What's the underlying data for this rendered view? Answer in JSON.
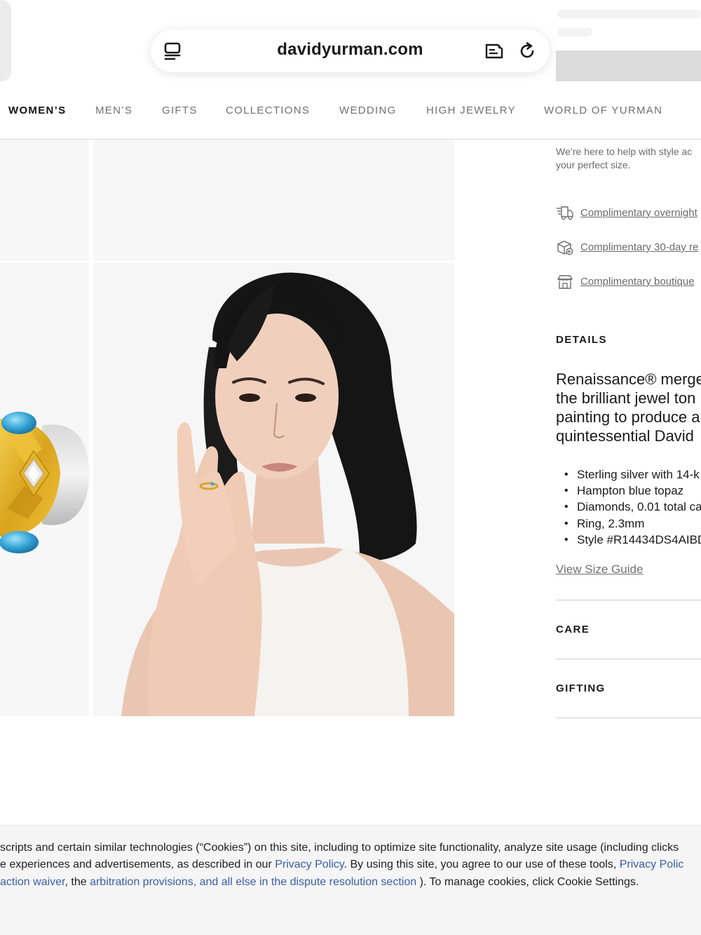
{
  "browser": {
    "url": "davidyurman.com"
  },
  "nav": {
    "items": [
      "WOMEN’S",
      "MEN’S",
      "GIFTS",
      "COLLECTIONS",
      "WEDDING",
      "HIGH JEWELRY",
      "WORLD OF YURMAN"
    ]
  },
  "product_info": {
    "help_line1": "We’re here to help with style ac",
    "help_line2": "your perfect size.",
    "services": [
      {
        "label": "Complimentary overnight",
        "icon": "delivery-truck-icon"
      },
      {
        "label": "Complimentary 30-day re",
        "icon": "return-box-icon"
      },
      {
        "label": "Complimentary boutique",
        "icon": "storefront-icon"
      }
    ]
  },
  "details": {
    "title": "DETAILS",
    "description_lines": [
      "Renaissance® merge",
      "the brilliant jewel ton",
      "painting to produce a",
      "quintessential David"
    ],
    "bullets": [
      "Sterling silver with 14-k",
      "Hampton blue topaz",
      "Diamonds, 0.01 total ca",
      "Ring, 2.3mm",
      "Style #R14434DS4AIBD"
    ],
    "size_guide_link": "View Size Guide"
  },
  "accordions": {
    "care": "CARE",
    "gifting": "GIFTING"
  },
  "cookie_banner": {
    "line1": "scripts and certain similar technologies (“Cookies”) on this site, including to optimize site functionality, analyze site usage (including clicks",
    "line2_a": "e experiences and advertisements, as described in our ",
    "line2_link1": "Privacy Policy",
    "line2_b": ". By using this site, you agree to our use of these tools, ",
    "line2_link2": "Privacy Polic",
    "line3_link1": "action waiver",
    "line3_a": ", the ",
    "line3_link2": "arbitration provisions, and all else in the dispute resolution section",
    "line3_b": " ). To manage cookies, click Cookie Settings."
  },
  "colors": {
    "link_blue": "#3a5fa8",
    "gold": "#e0b12e",
    "topaz": "#2f9fd0",
    "tile_bg": "#f7f7f7"
  }
}
